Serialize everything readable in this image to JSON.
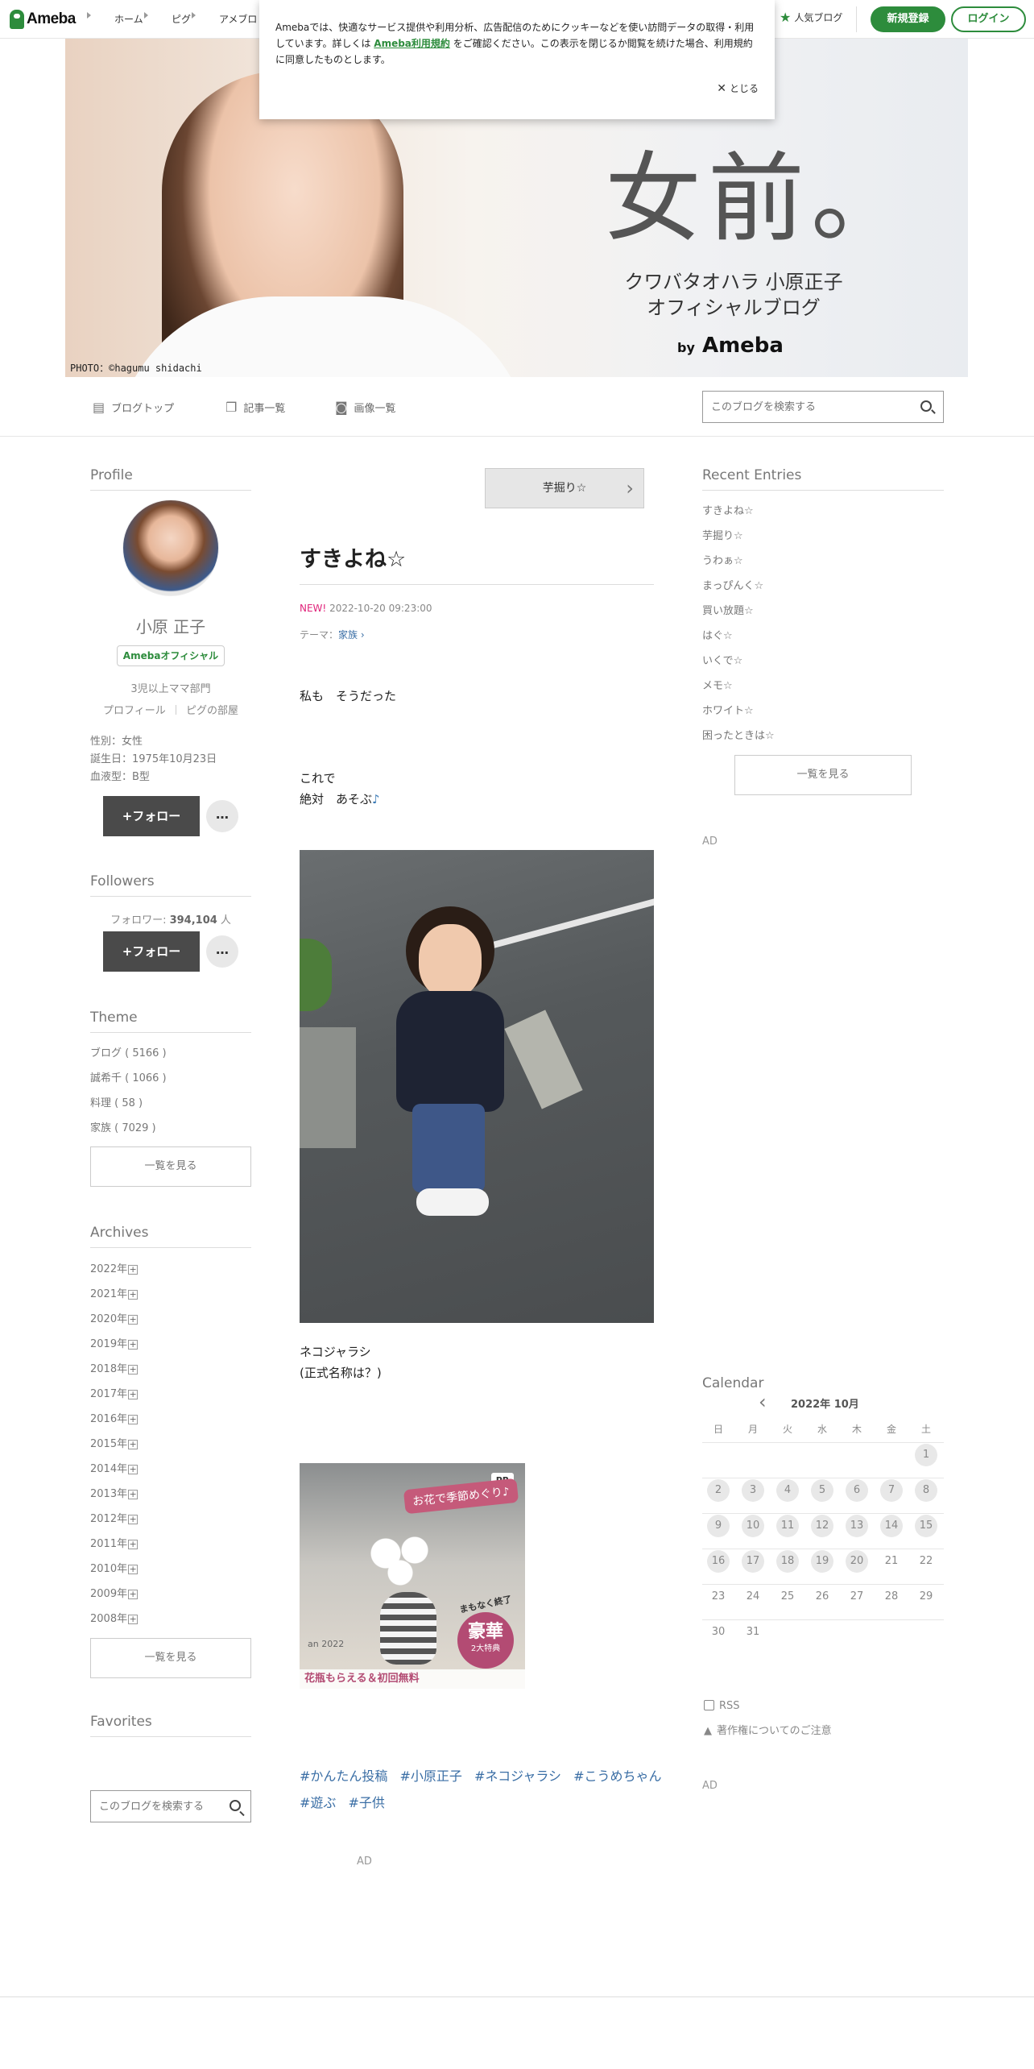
{
  "header": {
    "logo_text": "Ameba",
    "nav": [
      "ホーム",
      "ピグ",
      "アメブロ"
    ],
    "popular": "人気ブログ",
    "register": "新規登録",
    "login": "ログイン"
  },
  "cookie": {
    "text_1": "Amebaでは、快適なサービス提供や利用分析、広告配信のためにクッキーなどを使い訪問データの取得・利用しています。詳しくは",
    "link": "Ameba利用規約",
    "text_2": "をご確認ください。この表示を閉じるか閲覧を続けた場合、利用規約に同意したものとします。",
    "close": "とじる"
  },
  "banner": {
    "title": "女前。",
    "sub_1": "クワバタオハラ 小原正子",
    "sub_2": "オフィシャルブログ",
    "by": "by",
    "brand": "Ameba",
    "credit": "PHOTO：©hagumu shidachi"
  },
  "blog_nav": {
    "items": [
      "ブログトップ",
      "記事一覧",
      "画像一覧"
    ],
    "search_placeholder": "このブログを検索する"
  },
  "profile": {
    "heading": "Profile",
    "name": "小原 正子",
    "badge": "Amebaオフィシャル",
    "rank": "3児以上ママ部門",
    "link_profile": "プロフィール",
    "link_pig": "ピグの部屋",
    "gender": "性別：女性",
    "birthday": "誕生日：1975年10月23日",
    "blood": "血液型：B型",
    "follow": "+フォロー",
    "more": "…"
  },
  "followers": {
    "heading": "Followers",
    "label": "フォロワー: ",
    "count": "394,104",
    "unit": " 人",
    "follow": "+フォロー",
    "more": "…"
  },
  "theme": {
    "heading": "Theme",
    "items": [
      "ブログ ( 5166 )",
      "誠希千 ( 1066 )",
      "料理 ( 58 )",
      "家族 ( 7029 )"
    ],
    "see_all": "一覧を見る"
  },
  "archives": {
    "heading": "Archives",
    "items": [
      "2022年",
      "2021年",
      "2020年",
      "2019年",
      "2018年",
      "2017年",
      "2016年",
      "2015年",
      "2014年",
      "2013年",
      "2012年",
      "2011年",
      "2010年",
      "2009年",
      "2008年"
    ],
    "see_all": "一覧を見る"
  },
  "favorites": {
    "heading": "Favorites",
    "search_placeholder": "このブログを検索する"
  },
  "article": {
    "prev_title": "芋掘り☆",
    "title": "すきよね☆",
    "new_label": "NEW!",
    "datetime": "2022-10-20 09:23:00",
    "theme_label": "テーマ：",
    "theme": "家族",
    "p1": "私も　そうだった",
    "p2a": "これで",
    "p2b": "絶対　あそぶ",
    "p3a": "ネコジャラシ",
    "p3b": "(正式名称は？)",
    "ad_bubble": "お花で季節めぐり♪",
    "ad_pr": "PR",
    "ad_bottom": "花瓶もらえる＆初回無料",
    "ad_badge_top": "まもなく終了",
    "ad_badge_main": "豪華",
    "ad_badge_sub": "2大特典",
    "ad_calendar_text": "an 2022",
    "hashtags": [
      "#かんたん投稿",
      "#小原正子",
      "#ネコジャラシ",
      "#こうめちゃん",
      "#遊ぶ",
      "#子供"
    ],
    "ad_label": "AD"
  },
  "recent": {
    "heading": "Recent Entries",
    "items": [
      "すきよね☆",
      "芋掘り☆",
      "うわぁ☆",
      "まっぴんく☆",
      "買い放題☆",
      "はぐ☆",
      "いくで☆",
      "メモ☆",
      "ホワイト☆",
      "困ったときは☆"
    ],
    "see_all": "一覧を見る",
    "ad_label": "AD"
  },
  "calendar": {
    "heading": "Calendar",
    "month": "2022年 10月",
    "weekdays": [
      "日",
      "月",
      "火",
      "水",
      "木",
      "金",
      "土"
    ],
    "rss": "RSS",
    "copyright": "著作権についてのご注意",
    "ad_label": "AD"
  }
}
